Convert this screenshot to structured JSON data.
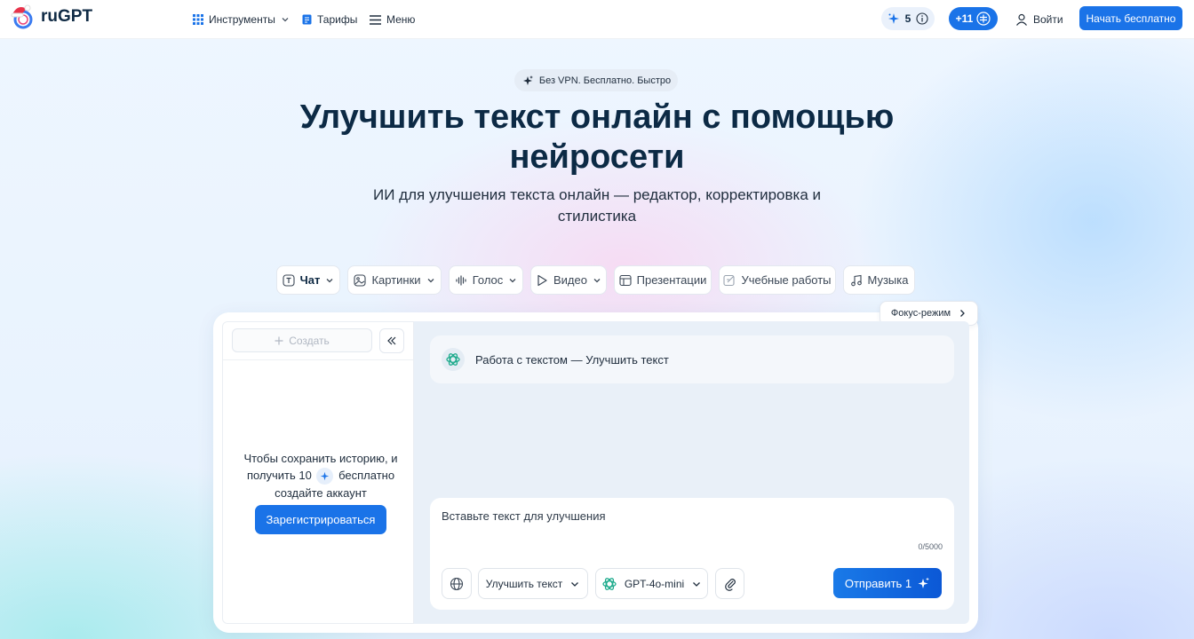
{
  "header": {
    "logo_text": "ruGPT",
    "nav": [
      {
        "label": "Инструменты",
        "icon": "grid-icon"
      },
      {
        "label": "Тарифы",
        "icon": "document-icon"
      },
      {
        "label": "Меню",
        "icon": "menu-icon"
      }
    ],
    "credits": "5",
    "plus_credits": "+11",
    "login_label": "Войти",
    "start_label": "Начать бесплатно"
  },
  "hero": {
    "badge": "Без VPN. Бесплатно. Быстро",
    "title": "Улучшить текст онлайн с помощью нейросети",
    "subtitle": "ИИ для улучшения текста онлайн — редактор, корректировка и стилистика"
  },
  "tabs": [
    {
      "label": "Чат",
      "active": true,
      "dropdown": true,
      "icon": "chat-t-icon"
    },
    {
      "label": "Картинки",
      "active": false,
      "dropdown": true,
      "icon": "image-icon"
    },
    {
      "label": "Голос",
      "active": false,
      "dropdown": true,
      "icon": "waveform-icon"
    },
    {
      "label": "Видео",
      "active": false,
      "dropdown": true,
      "icon": "play-icon"
    },
    {
      "label": "Презентации",
      "active": false,
      "dropdown": false,
      "icon": "presentation-icon"
    },
    {
      "label": "Учебные работы",
      "active": false,
      "dropdown": false,
      "icon": "edit-note-icon"
    },
    {
      "label": "Музыка",
      "active": false,
      "dropdown": false,
      "icon": "music-icon"
    }
  ],
  "focus_mode_label": "Фокус-режим",
  "sidebar": {
    "create_label": "Создать",
    "save_line1": "Чтобы сохранить историю, и",
    "save_line2_a": "получить 10",
    "save_line2_b": "бесплатно",
    "save_line3": "создайте аккаунт",
    "register_label": "Зарегистрироваться"
  },
  "chat": {
    "message": "Работа с текстом — Улучшить текст",
    "input_placeholder": "Вставьте текст для улучшения",
    "input_value": "",
    "counter": "0/5000",
    "mode_label": "Улучшить текст",
    "model_label": "GPT-4o-mini",
    "send_label": "Отправить 1"
  },
  "colors": {
    "accent": "#1a73e8",
    "text_dark": "#0c2a45",
    "chat_bg": "#e9f0f8"
  }
}
